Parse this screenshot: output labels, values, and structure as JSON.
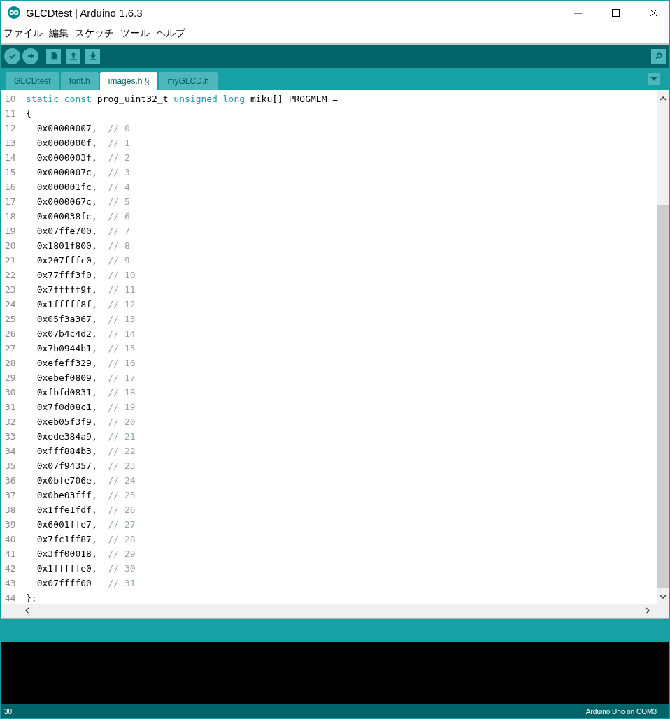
{
  "window": {
    "title": "GLCDtest | Arduino 1.6.3"
  },
  "menu": [
    "ファイル",
    "編集",
    "スケッチ",
    "ツール",
    "ヘルプ"
  ],
  "toolbar": {
    "buttons": [
      {
        "kind": "verify"
      },
      {
        "kind": "upload"
      },
      {
        "kind": "new"
      },
      {
        "kind": "open"
      },
      {
        "kind": "save"
      }
    ],
    "right": [
      {
        "kind": "monitor"
      }
    ]
  },
  "tabs": [
    {
      "label": "GLCDtest",
      "selected": false
    },
    {
      "label": "font.h",
      "selected": false
    },
    {
      "label": "images.h §",
      "selected": true
    },
    {
      "label": "myGLCD.h",
      "selected": false
    }
  ],
  "editor": {
    "lines": [
      {
        "number": "10",
        "tokens": [
          {
            "kind": "keyword",
            "text": "static const"
          },
          {
            "kind": "plain",
            "text": " prog_uint32_t "
          },
          {
            "kind": "keyword",
            "text": "unsigned long"
          },
          {
            "kind": "plain",
            "text": " miku[] PROGMEM ="
          }
        ]
      },
      {
        "number": "11",
        "tokens": [
          {
            "kind": "plain",
            "text": "{"
          }
        ]
      },
      {
        "number": "12",
        "tokens": [
          {
            "kind": "plain",
            "text": "  0x00000007,  "
          },
          {
            "kind": "comment",
            "text": "// 0"
          }
        ]
      },
      {
        "number": "13",
        "tokens": [
          {
            "kind": "plain",
            "text": "  0x0000000f,  "
          },
          {
            "kind": "comment",
            "text": "// 1"
          }
        ]
      },
      {
        "number": "14",
        "tokens": [
          {
            "kind": "plain",
            "text": "  0x0000003f,  "
          },
          {
            "kind": "comment",
            "text": "// 2"
          }
        ]
      },
      {
        "number": "15",
        "tokens": [
          {
            "kind": "plain",
            "text": "  0x0000007c,  "
          },
          {
            "kind": "comment",
            "text": "// 3"
          }
        ]
      },
      {
        "number": "16",
        "tokens": [
          {
            "kind": "plain",
            "text": "  0x000001fc,  "
          },
          {
            "kind": "comment",
            "text": "// 4"
          }
        ]
      },
      {
        "number": "17",
        "tokens": [
          {
            "kind": "plain",
            "text": "  0x0000067c,  "
          },
          {
            "kind": "comment",
            "text": "// 5"
          }
        ]
      },
      {
        "number": "18",
        "tokens": [
          {
            "kind": "plain",
            "text": "  0x000038fc,  "
          },
          {
            "kind": "comment",
            "text": "// 6"
          }
        ]
      },
      {
        "number": "19",
        "tokens": [
          {
            "kind": "plain",
            "text": "  0x07ffe700,  "
          },
          {
            "kind": "comment",
            "text": "// 7"
          }
        ]
      },
      {
        "number": "20",
        "tokens": [
          {
            "kind": "plain",
            "text": "  0x1801f800,  "
          },
          {
            "kind": "comment",
            "text": "// 8"
          }
        ]
      },
      {
        "number": "21",
        "tokens": [
          {
            "kind": "plain",
            "text": "  0x207fffc0,  "
          },
          {
            "kind": "comment",
            "text": "// 9"
          }
        ]
      },
      {
        "number": "22",
        "tokens": [
          {
            "kind": "plain",
            "text": "  0x77fff3f0,  "
          },
          {
            "kind": "comment",
            "text": "// 10"
          }
        ]
      },
      {
        "number": "23",
        "tokens": [
          {
            "kind": "plain",
            "text": "  0x7fffff9f,  "
          },
          {
            "kind": "comment",
            "text": "// 11"
          }
        ]
      },
      {
        "number": "24",
        "tokens": [
          {
            "kind": "plain",
            "text": "  0x1fffff8f,  "
          },
          {
            "kind": "comment",
            "text": "// 12"
          }
        ]
      },
      {
        "number": "25",
        "tokens": [
          {
            "kind": "plain",
            "text": "  0x05f3a367,  "
          },
          {
            "kind": "comment",
            "text": "// 13"
          }
        ]
      },
      {
        "number": "26",
        "tokens": [
          {
            "kind": "plain",
            "text": "  0x07b4c4d2,  "
          },
          {
            "kind": "comment",
            "text": "// 14"
          }
        ]
      },
      {
        "number": "27",
        "tokens": [
          {
            "kind": "plain",
            "text": "  0x7b0944b1,  "
          },
          {
            "kind": "comment",
            "text": "// 15"
          }
        ]
      },
      {
        "number": "28",
        "tokens": [
          {
            "kind": "plain",
            "text": "  0xefeff329,  "
          },
          {
            "kind": "comment",
            "text": "// 16"
          }
        ]
      },
      {
        "number": "29",
        "tokens": [
          {
            "kind": "plain",
            "text": "  0xebef0809,  "
          },
          {
            "kind": "comment",
            "text": "// 17"
          }
        ]
      },
      {
        "number": "30",
        "tokens": [
          {
            "kind": "plain",
            "text": "  0xfbfd0831,  "
          },
          {
            "kind": "comment",
            "text": "// 18"
          }
        ]
      },
      {
        "number": "31",
        "tokens": [
          {
            "kind": "plain",
            "text": "  0x7f0d08c1,  "
          },
          {
            "kind": "comment",
            "text": "// 19"
          }
        ]
      },
      {
        "number": "32",
        "tokens": [
          {
            "kind": "plain",
            "text": "  0xeb05f3f9,  "
          },
          {
            "kind": "comment",
            "text": "// 20"
          }
        ]
      },
      {
        "number": "33",
        "tokens": [
          {
            "kind": "plain",
            "text": "  0xede384a9,  "
          },
          {
            "kind": "comment",
            "text": "// 21"
          }
        ]
      },
      {
        "number": "34",
        "tokens": [
          {
            "kind": "plain",
            "text": "  0xfff884b3,  "
          },
          {
            "kind": "comment",
            "text": "// 22"
          }
        ]
      },
      {
        "number": "35",
        "tokens": [
          {
            "kind": "plain",
            "text": "  0x07f94357,  "
          },
          {
            "kind": "comment",
            "text": "// 23"
          }
        ]
      },
      {
        "number": "36",
        "tokens": [
          {
            "kind": "plain",
            "text": "  0x0bfe706e,  "
          },
          {
            "kind": "comment",
            "text": "// 24"
          }
        ]
      },
      {
        "number": "37",
        "tokens": [
          {
            "kind": "plain",
            "text": "  0x0be03fff,  "
          },
          {
            "kind": "comment",
            "text": "// 25"
          }
        ]
      },
      {
        "number": "38",
        "tokens": [
          {
            "kind": "plain",
            "text": "  0x1ffe1fdf,  "
          },
          {
            "kind": "comment",
            "text": "// 26"
          }
        ]
      },
      {
        "number": "39",
        "tokens": [
          {
            "kind": "plain",
            "text": "  0x6001ffe7,  "
          },
          {
            "kind": "comment",
            "text": "// 27"
          }
        ]
      },
      {
        "number": "40",
        "tokens": [
          {
            "kind": "plain",
            "text": "  0x7fc1ff87,  "
          },
          {
            "kind": "comment",
            "text": "// 28"
          }
        ]
      },
      {
        "number": "41",
        "tokens": [
          {
            "kind": "plain",
            "text": "  0x3ff00018,  "
          },
          {
            "kind": "comment",
            "text": "// 29"
          }
        ]
      },
      {
        "number": "42",
        "tokens": [
          {
            "kind": "plain",
            "text": "  0x1fffffe0,  "
          },
          {
            "kind": "comment",
            "text": "// 30"
          }
        ]
      },
      {
        "number": "43",
        "tokens": [
          {
            "kind": "plain",
            "text": "  0x07ffff00   "
          },
          {
            "kind": "comment",
            "text": "// 31"
          }
        ]
      },
      {
        "number": "44",
        "tokens": [
          {
            "kind": "plain",
            "text": "};"
          }
        ]
      }
    ]
  },
  "status_bar": {
    "line": "30",
    "board": "Arduino Uno on COM3"
  }
}
